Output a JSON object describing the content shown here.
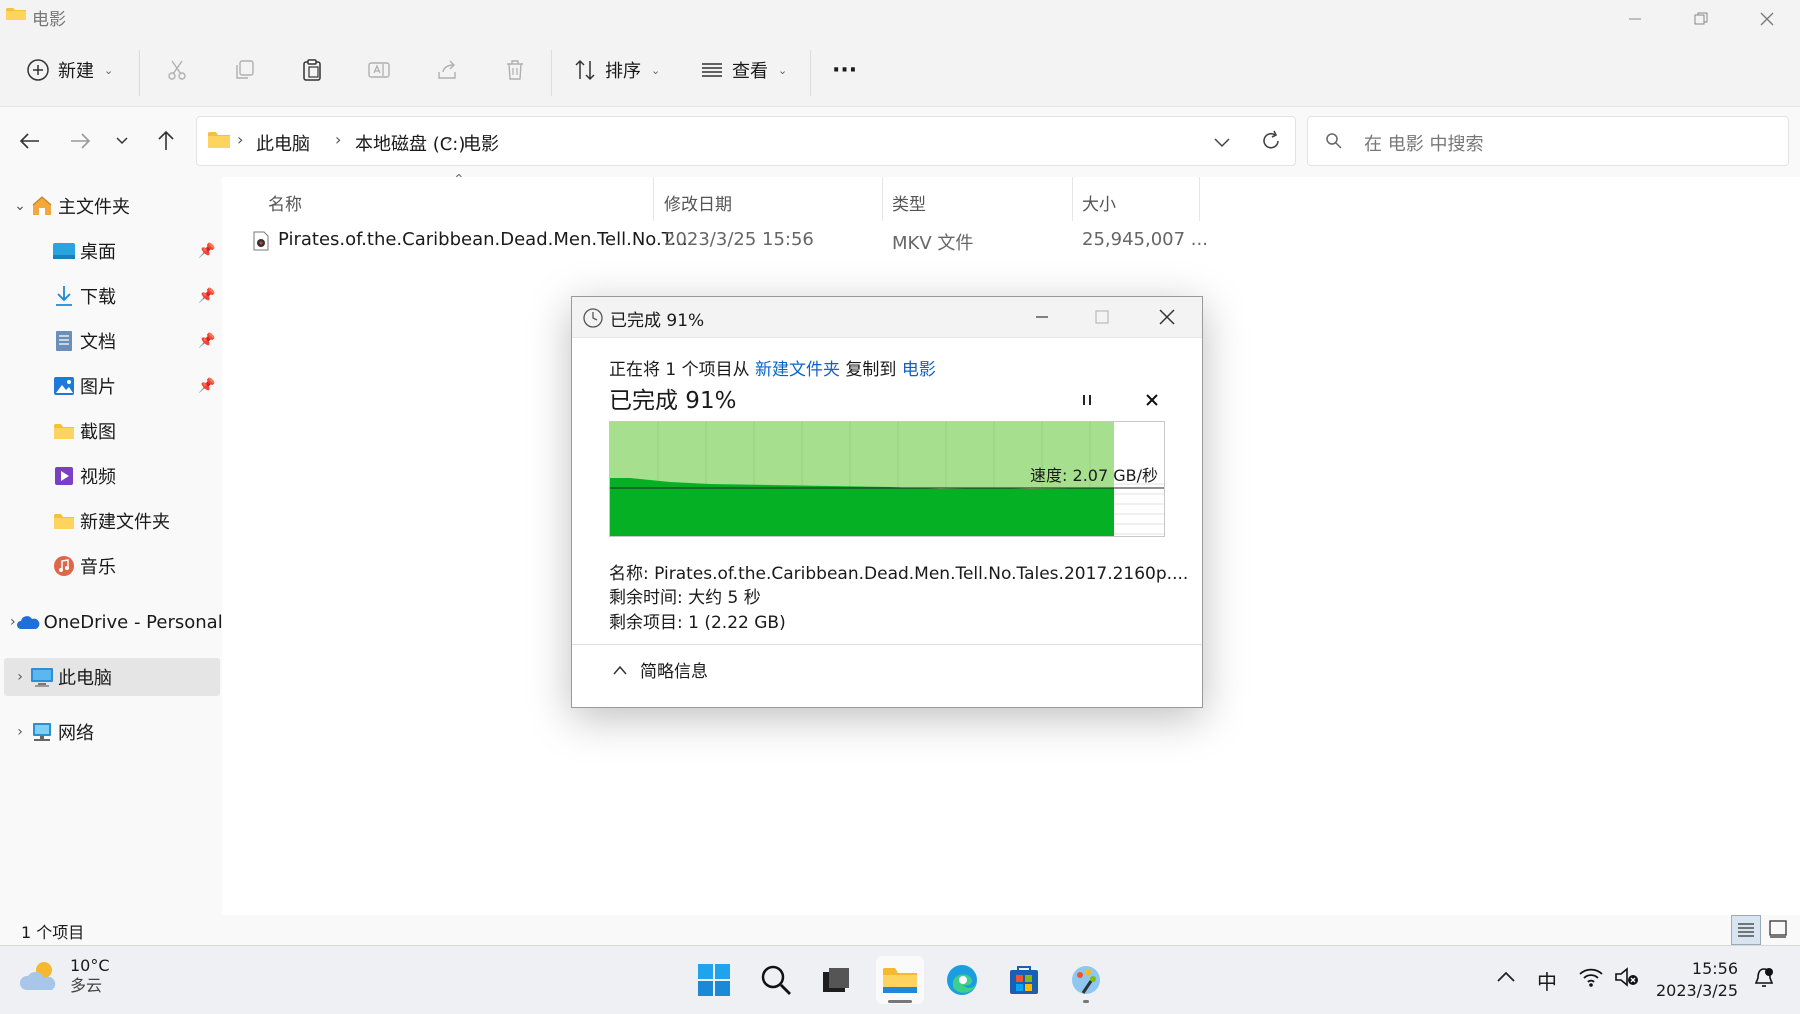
{
  "window": {
    "title": "电影"
  },
  "toolbar": {
    "new_label": "新建",
    "sort_label": "排序",
    "view_label": "查看",
    "more_label": "···"
  },
  "address": {
    "crumbs": [
      "此电脑",
      "本地磁盘 (C:)",
      "电影"
    ],
    "search_placeholder": "在 电影 中搜索"
  },
  "sidebar": {
    "home": "主文件夹",
    "items": [
      {
        "label": "桌面",
        "icon": "desktop-icon",
        "pinned": true
      },
      {
        "label": "下载",
        "icon": "download-icon",
        "pinned": true
      },
      {
        "label": "文档",
        "icon": "document-icon",
        "pinned": true
      },
      {
        "label": "图片",
        "icon": "pictures-icon",
        "pinned": true
      },
      {
        "label": "截图",
        "icon": "folder-icon",
        "pinned": false
      },
      {
        "label": "视频",
        "icon": "video-icon",
        "pinned": false
      },
      {
        "label": "新建文件夹",
        "icon": "folder-icon",
        "pinned": false
      },
      {
        "label": "音乐",
        "icon": "music-icon",
        "pinned": false
      }
    ],
    "onedrive": "OneDrive - Personal",
    "this_pc": "此电脑",
    "network": "网络"
  },
  "columns": {
    "name": "名称",
    "modified": "修改日期",
    "type": "类型",
    "size": "大小"
  },
  "files": [
    {
      "name": "Pirates.of.the.Caribbean.Dead.Men.Tell.No.T...",
      "modified": "2023/3/25 15:56",
      "type": "MKV 文件",
      "size": "25,945,007 ..."
    }
  ],
  "status": {
    "count": "1 个项目"
  },
  "dialog": {
    "title": "已完成 91%",
    "copy_prefix": "正在将 1 个项目从",
    "source": "新建文件夹",
    "copy_mid": "复制到",
    "destination": "电影",
    "progress_heading": "已完成 91%",
    "progress_percent": 91,
    "speed": "速度: 2.07 GB/秒",
    "name_line": "名称: Pirates.of.the.Caribbean.Dead.Men.Tell.No.Tales.2017.2160p....",
    "time_line": "剩余时间: 大约 5 秒",
    "items_line": "剩余项目: 1 (2.22 GB)",
    "less_details": "简略信息"
  },
  "taskbar": {
    "weather_temp": "10°C",
    "weather_desc": "多云",
    "ime": "中",
    "clock_time": "15:56",
    "clock_date": "2023/3/25"
  },
  "colors": {
    "accent": "#0a64c8",
    "progress_light": "#a6e08f",
    "progress_dark": "#06b025",
    "folder": "#f8c84a"
  }
}
